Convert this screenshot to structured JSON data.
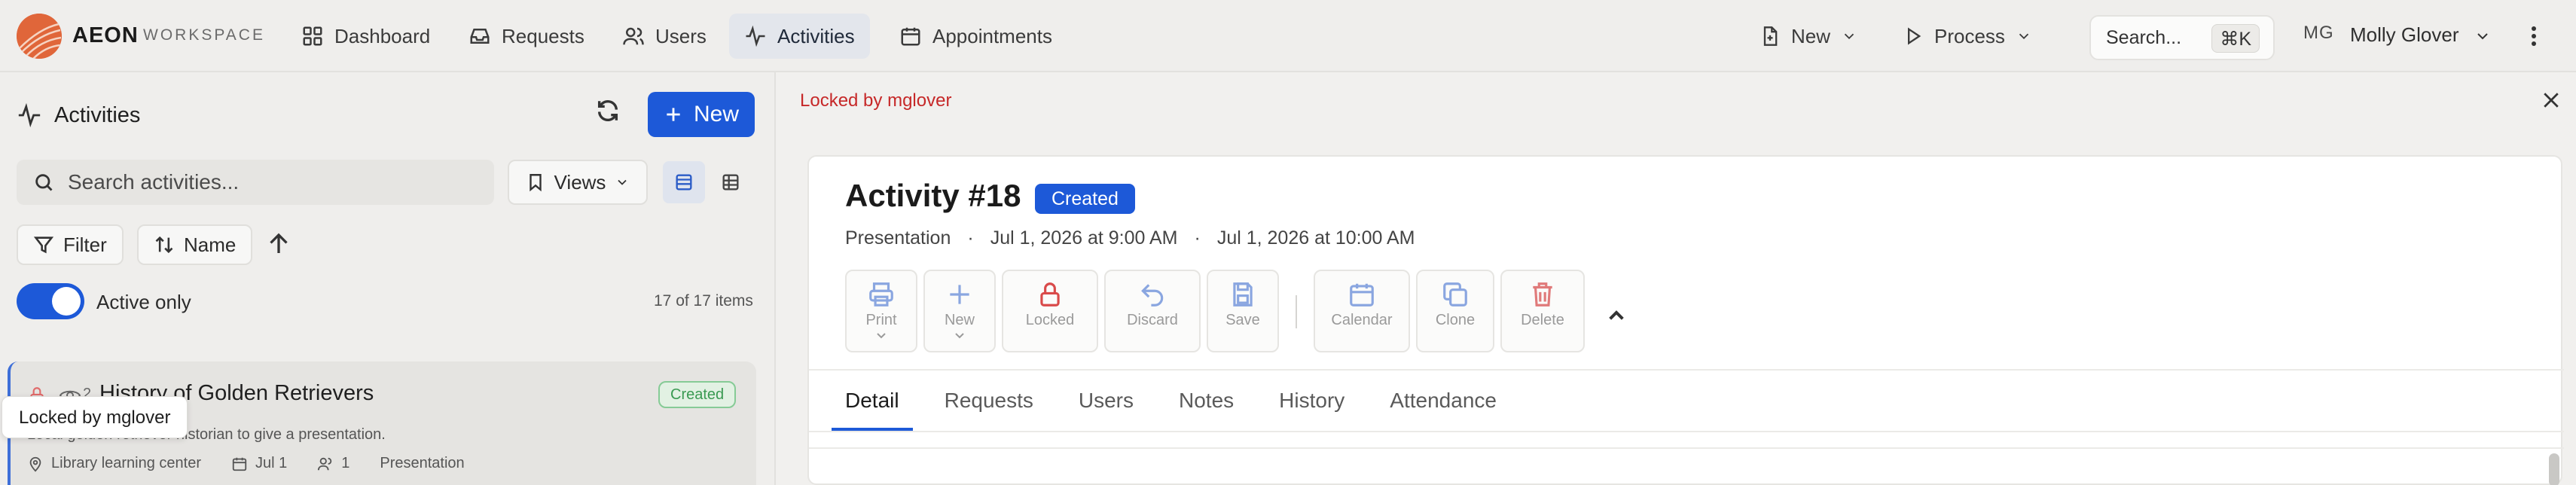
{
  "app": {
    "brand": "AEON",
    "brand_sub": "WORKSPACE",
    "accent": "#1d59d8"
  },
  "nav": [
    {
      "label": "Dashboard",
      "icon": "grid-icon"
    },
    {
      "label": "Requests",
      "icon": "inbox-icon"
    },
    {
      "label": "Users",
      "icon": "users-icon"
    },
    {
      "label": "Activities",
      "icon": "activity-icon",
      "active": true
    },
    {
      "label": "Appointments",
      "icon": "calendar-icon"
    }
  ],
  "topbar": {
    "new_label": "New",
    "process_label": "Process",
    "search_label": "Search...",
    "search_shortcut": "⌘K",
    "user_initials": "MG",
    "user_name": "Molly Glover"
  },
  "list_panel": {
    "title": "Activities",
    "new_button": "New",
    "search_placeholder": "Search activities...",
    "views_label": "Views",
    "filter_label": "Filter",
    "sort_label": "Name",
    "active_only_label": "Active only",
    "active_only": true,
    "count_text": "17 of 17 items",
    "tooltip": "Locked by mglover",
    "items": [
      {
        "title": "History of Golden Retrievers",
        "views": "2",
        "status": "Created",
        "description": "Local golden retriever historian to give a presentation.",
        "location": "Library learning center",
        "date": "Jul 1",
        "attendees": "1",
        "type": "Presentation"
      }
    ]
  },
  "detail": {
    "locked_message": "Locked by mglover",
    "title": "Activity #18",
    "status": "Created",
    "type": "Presentation",
    "start": "Jul 1, 2026 at 9:00 AM",
    "end": "Jul 1, 2026 at 10:00 AM",
    "separator": "·",
    "toolbar": [
      {
        "label": "Print",
        "icon": "printer-icon"
      },
      {
        "label": "New",
        "icon": "plus-icon"
      },
      {
        "label": "Locked",
        "icon": "lock-icon"
      },
      {
        "label": "Discard",
        "icon": "undo-icon"
      },
      {
        "label": "Save",
        "icon": "save-icon"
      },
      {
        "label": "Calendar",
        "icon": "calendar-icon"
      },
      {
        "label": "Clone",
        "icon": "copy-icon"
      },
      {
        "label": "Delete",
        "icon": "trash-icon"
      }
    ],
    "tabs": [
      "Detail",
      "Requests",
      "Users",
      "Notes",
      "History",
      "Attendance"
    ],
    "active_tab": "Detail"
  }
}
